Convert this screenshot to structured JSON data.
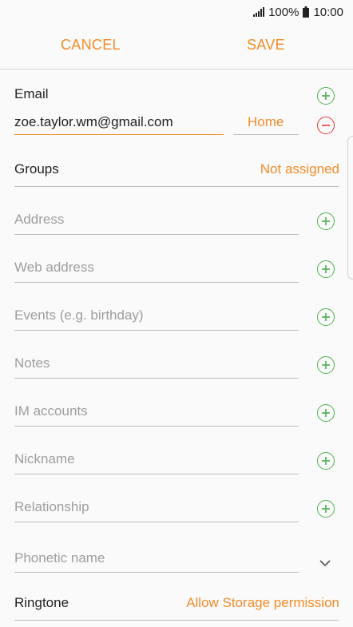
{
  "status_bar": {
    "battery": "100%",
    "time": "10:00",
    "icons": [
      "signal-icon",
      "battery-icon"
    ]
  },
  "action_bar": {
    "cancel_label": "CANCEL",
    "save_label": "SAVE"
  },
  "email": {
    "label": "Email",
    "value": "zoe.taylor.wm@gmail.com",
    "type": "Home"
  },
  "groups": {
    "label": "Groups",
    "value": "Not assigned"
  },
  "fields": [
    {
      "placeholder": "Address"
    },
    {
      "placeholder": "Web address"
    },
    {
      "placeholder": "Events (e.g. birthday)"
    },
    {
      "placeholder": "Notes"
    },
    {
      "placeholder": "IM accounts"
    },
    {
      "placeholder": "Nickname"
    },
    {
      "placeholder": "Relationship"
    },
    {
      "placeholder": "Phonetic name"
    }
  ],
  "ringtone": {
    "label": "Ringtone",
    "value": "Allow Storage permission"
  },
  "colors": {
    "accent": "#f28c28",
    "add": "#4caf50",
    "remove": "#e53935"
  }
}
